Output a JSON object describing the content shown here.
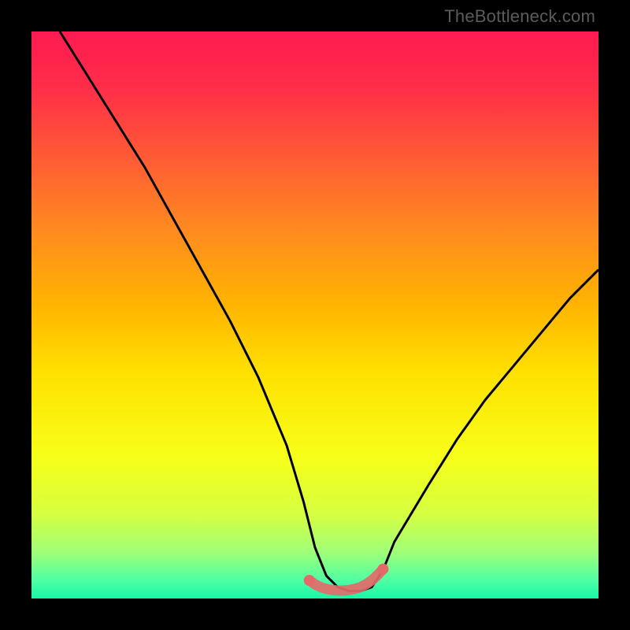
{
  "watermark": {
    "text": "TheBottleneck.com"
  },
  "gradient": {
    "stops": [
      {
        "offset": 0.0,
        "color": "#ff1a52"
      },
      {
        "offset": 0.1,
        "color": "#ff2e48"
      },
      {
        "offset": 0.22,
        "color": "#ff5a35"
      },
      {
        "offset": 0.35,
        "color": "#ff8a1f"
      },
      {
        "offset": 0.48,
        "color": "#ffb300"
      },
      {
        "offset": 0.6,
        "color": "#ffe000"
      },
      {
        "offset": 0.75,
        "color": "#f7ff1a"
      },
      {
        "offset": 0.85,
        "color": "#d6ff40"
      },
      {
        "offset": 0.92,
        "color": "#9eff7a"
      },
      {
        "offset": 0.97,
        "color": "#4bffa5"
      },
      {
        "offset": 1.0,
        "color": "#19f5a6"
      }
    ]
  },
  "chart_data": {
    "type": "line",
    "title": "",
    "xlabel": "",
    "ylabel": "",
    "xlim": [
      0,
      100
    ],
    "ylim": [
      0,
      100
    ],
    "series": [
      {
        "name": "main-curve",
        "color": "#000000",
        "x": [
          5,
          10,
          15,
          20,
          25,
          30,
          35,
          40,
          45,
          48,
          50,
          52,
          54,
          56,
          58,
          60,
          62,
          64,
          70,
          75,
          80,
          85,
          90,
          95,
          100
        ],
        "y": [
          100,
          92,
          84,
          76,
          67,
          58,
          49,
          39,
          27,
          17,
          9,
          4,
          2,
          1.3,
          1.3,
          2,
          5,
          10,
          20,
          28,
          35,
          41,
          47,
          53,
          58
        ]
      },
      {
        "name": "highlight-band",
        "color": "#e46a6a",
        "x": [
          49,
          50,
          51,
          52,
          53,
          54,
          55,
          56,
          57,
          58,
          59,
          60,
          61,
          62
        ],
        "y": [
          3.2,
          2.5,
          2.0,
          1.7,
          1.5,
          1.4,
          1.4,
          1.5,
          1.7,
          2.0,
          2.5,
          3.2,
          4.1,
          5.2
        ]
      }
    ]
  }
}
